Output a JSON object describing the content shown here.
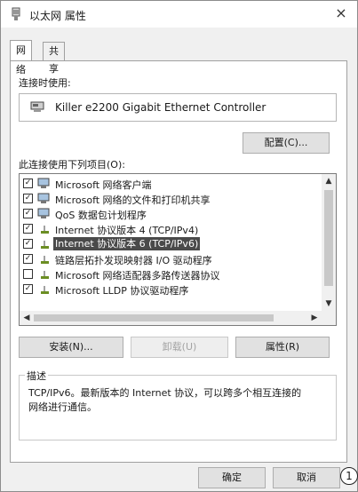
{
  "window": {
    "title": "以太网 属性",
    "close_glyph": "×"
  },
  "tabs": [
    {
      "label": "网络"
    },
    {
      "label": "共享"
    }
  ],
  "connect_using": {
    "label": "连接时使用:",
    "adapter_name": "Killer e2200 Gigabit Ethernet Controller",
    "configure_button": "配置(C)..."
  },
  "items_section": {
    "label": "此连接使用下列项目(O):",
    "items": [
      {
        "label": "Microsoft 网络客户端",
        "checked": true,
        "selected": false,
        "icon": "network-client-icon"
      },
      {
        "label": "Microsoft 网络的文件和打印机共享",
        "checked": true,
        "selected": false,
        "icon": "file-printer-sharing-icon"
      },
      {
        "label": "QoS 数据包计划程序",
        "checked": true,
        "selected": false,
        "icon": "qos-scheduler-icon"
      },
      {
        "label": "Internet 协议版本 4 (TCP/IPv4)",
        "checked": true,
        "selected": false,
        "icon": "protocol-icon"
      },
      {
        "label": "Internet 协议版本 6 (TCP/IPv6)",
        "checked": true,
        "selected": true,
        "icon": "protocol-icon"
      },
      {
        "label": "链路层拓扑发现映射器 I/O 驱动程序",
        "checked": true,
        "selected": false,
        "icon": "protocol-icon"
      },
      {
        "label": "Microsoft 网络适配器多路传送器协议",
        "checked": false,
        "selected": false,
        "icon": "protocol-icon"
      },
      {
        "label": "Microsoft LLDP 协议驱动程序",
        "checked": true,
        "selected": false,
        "icon": "protocol-icon"
      }
    ]
  },
  "action_buttons": {
    "install": "安装(N)...",
    "uninstall": "卸载(U)",
    "properties": "属性(R)"
  },
  "description": {
    "title": "描述",
    "text_line1": "TCP/IPv6。最新版本的 Internet 协议，可以跨多个相互连接的",
    "text_line2": "网络进行通信。"
  },
  "footer": {
    "ok": "确定",
    "cancel": "取消"
  },
  "annotation": {
    "label": "1"
  },
  "colors": {
    "selection": "#4a4a4a",
    "window_bg": "#f0f0f0"
  }
}
